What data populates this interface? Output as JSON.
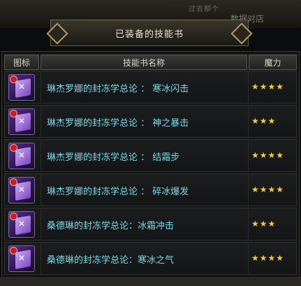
{
  "background": {
    "top_text_1": "过去那个",
    "top_text_2": "数据对店"
  },
  "window": {
    "title": "已装备的技能书"
  },
  "table": {
    "headers": {
      "icon": "图标",
      "name": "技能书名称",
      "power": "魔力"
    },
    "rows": [
      {
        "name": "琳杰罗娜的封冻学总论 ： 寒冰闪击",
        "stars": "★★★★"
      },
      {
        "name": "琳杰罗娜的封冻学总论 ： 神之暴击",
        "stars": "★★★"
      },
      {
        "name": "琳杰罗娜的封冻学总论 ： 结霜步",
        "stars": "★★★★"
      },
      {
        "name": "琳杰罗娜的封冻学总论 ： 碎冰爆发",
        "stars": "★★★★"
      },
      {
        "name": "桑德琳的封冻学总论：冰霜冲击",
        "stars": "★★★"
      },
      {
        "name": "桑德琳的封冻学总论：寒冰之气",
        "stars": "★★★★"
      }
    ]
  },
  "colors": {
    "name_text": "#7fd7e8",
    "star": "#f3c94a",
    "header_text": "#dcd7c6"
  },
  "icons": {
    "row_icon": "skill-book-icon",
    "lock": "lock-icon"
  }
}
